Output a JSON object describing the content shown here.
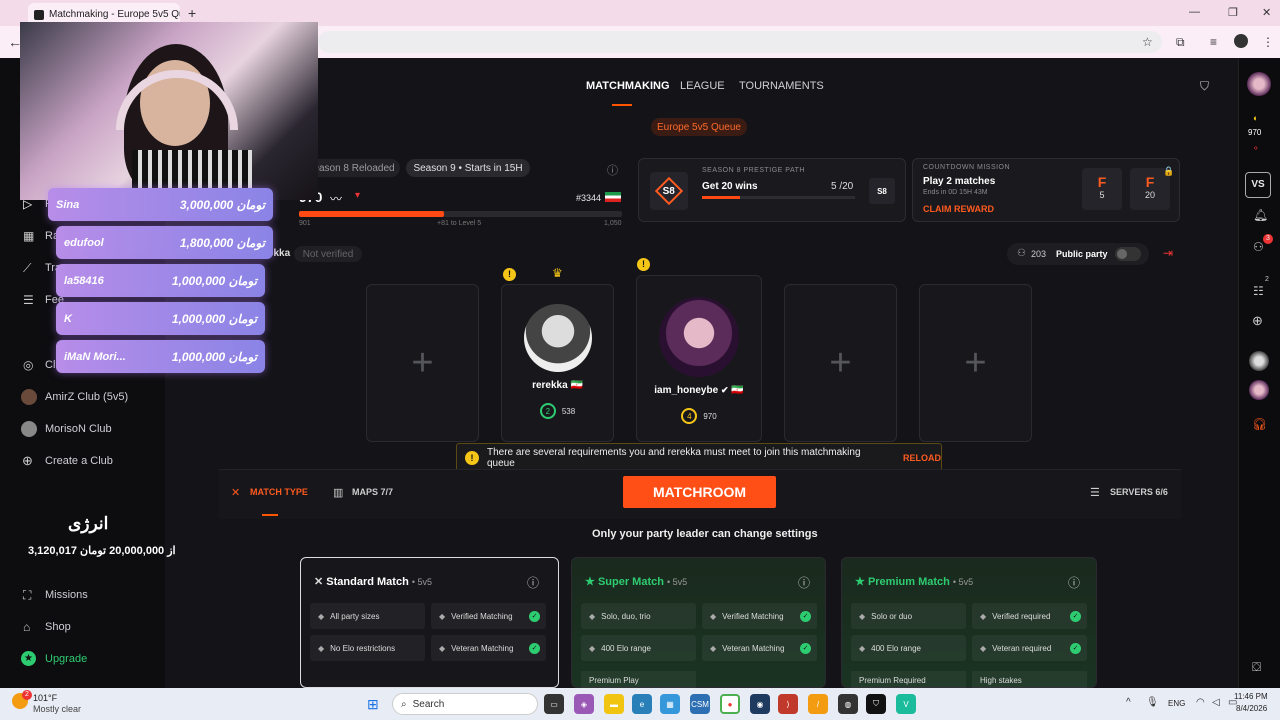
{
  "browser": {
    "tab_title": "Matchmaking - Europe 5v5 Qu",
    "new_tab": "+",
    "close": "✕",
    "back": "←",
    "minimize": "—",
    "restore": "❐",
    "close_window": "✕"
  },
  "topnav": {
    "items": [
      "MATCHMAKING",
      "LEAGUE",
      "TOURNAMENTS"
    ],
    "active": "MATCHMAKING"
  },
  "queue_badge": "Europe 5v5 Queue",
  "season": {
    "tab1": "eason 8 Reloaded",
    "tab2": "Season 9 • Starts in 15H",
    "elo": "970",
    "level_start": "901",
    "level_end": "1,050",
    "level_hint": "+81 to Level 5",
    "rank": "#3344",
    "progress": 0.45
  },
  "prestige": {
    "title": "SEASON 8 PRESTIGE PATH",
    "badge": "S8",
    "goal": "Get 20 wins",
    "count": "5 /20",
    "badge2": "S8",
    "progress": 0.25
  },
  "countdown": {
    "title": "COUNTDOWN MISSION",
    "task": "Play 2 matches",
    "ends": "Ends in 0D 15H 43M",
    "claim": "CLAIM REWARD",
    "r1_grade": "F",
    "r1_val": "5",
    "r2_grade": "F",
    "r2_val": "20"
  },
  "party": {
    "leader_tag": "rekka",
    "not_verified": "Not verified",
    "count": "203",
    "label": "Public party"
  },
  "players": [
    {
      "name": "rerekka",
      "level": "2",
      "elo": "538",
      "flag": "🇮🇷"
    },
    {
      "name": "iam_honeybe",
      "level": "4",
      "elo": "970",
      "flag": "🇮🇷"
    }
  ],
  "warning": {
    "text": "There are several requirements you and rerekka must meet to join this matchmaking queue",
    "reload": "RELOAD",
    "icon": "!"
  },
  "settings": {
    "match_type": "MATCH TYPE",
    "maps": "MAPS 7/7",
    "matchroom": "MATCHROOM",
    "servers": "SERVERS 6/6",
    "notice": "Only your party leader can change settings"
  },
  "match_cards": [
    {
      "title": "Standard Match",
      "sub": "• 5v5",
      "f1": "All party sizes",
      "f2": "Verified Matching",
      "f3": "No Elo restrictions",
      "f4": "Veteran Matching",
      "f5": ""
    },
    {
      "title": "Super Match",
      "sub": "• 5v5",
      "f1": "Solo, duo, trio",
      "f2": "Verified Matching",
      "f3": "400 Elo range",
      "f4": "Veteran Matching",
      "f5": "Premium Play"
    },
    {
      "title": "Premium Match",
      "sub": "• 5v5",
      "f1": "Solo or duo",
      "f2": "Verified required",
      "f3": "400 Elo range",
      "f4": "Veteran required",
      "f5": "Premium Required",
      "f6": "High stakes"
    }
  ],
  "leftnav": {
    "play": "P",
    "ranking": "Ra",
    "track": "Tra",
    "feed": "Fee",
    "clubs": "Clu",
    "club1": "AmirZ Club (5v5)",
    "club2": "MorisoN Club",
    "create": "Create a Club",
    "missions": "Missions",
    "shop": "Shop",
    "upgrade": "Upgrade"
  },
  "donations": [
    {
      "name": "Sina",
      "amount": "3,000,000 تومان"
    },
    {
      "name": "edufool",
      "amount": "1,800,000 تومان"
    },
    {
      "name": "la58416",
      "amount": "1,000,000 تومان"
    },
    {
      "name": "K",
      "amount": "1,000,000 تومان"
    },
    {
      "name": "iMaN Mori...",
      "amount": "1,000,000 تومان"
    }
  ],
  "goal": {
    "title": "انرژی",
    "line": "3,120,017 از 20,000,000 تومان"
  },
  "rightrail": {
    "elo": "970",
    "vs": "VS",
    "friends_badge": "3",
    "party_badge": "2"
  },
  "taskbar": {
    "temp": "101°F",
    "weather": "Mostly clear",
    "search": "Search",
    "lang": "ENG",
    "time": "11:46 PM",
    "date": "8/4/2026",
    "weather_badge": "2"
  },
  "colors": {
    "accent": "#ff5500",
    "green": "#2ecc71",
    "warn": "#f5c518"
  }
}
